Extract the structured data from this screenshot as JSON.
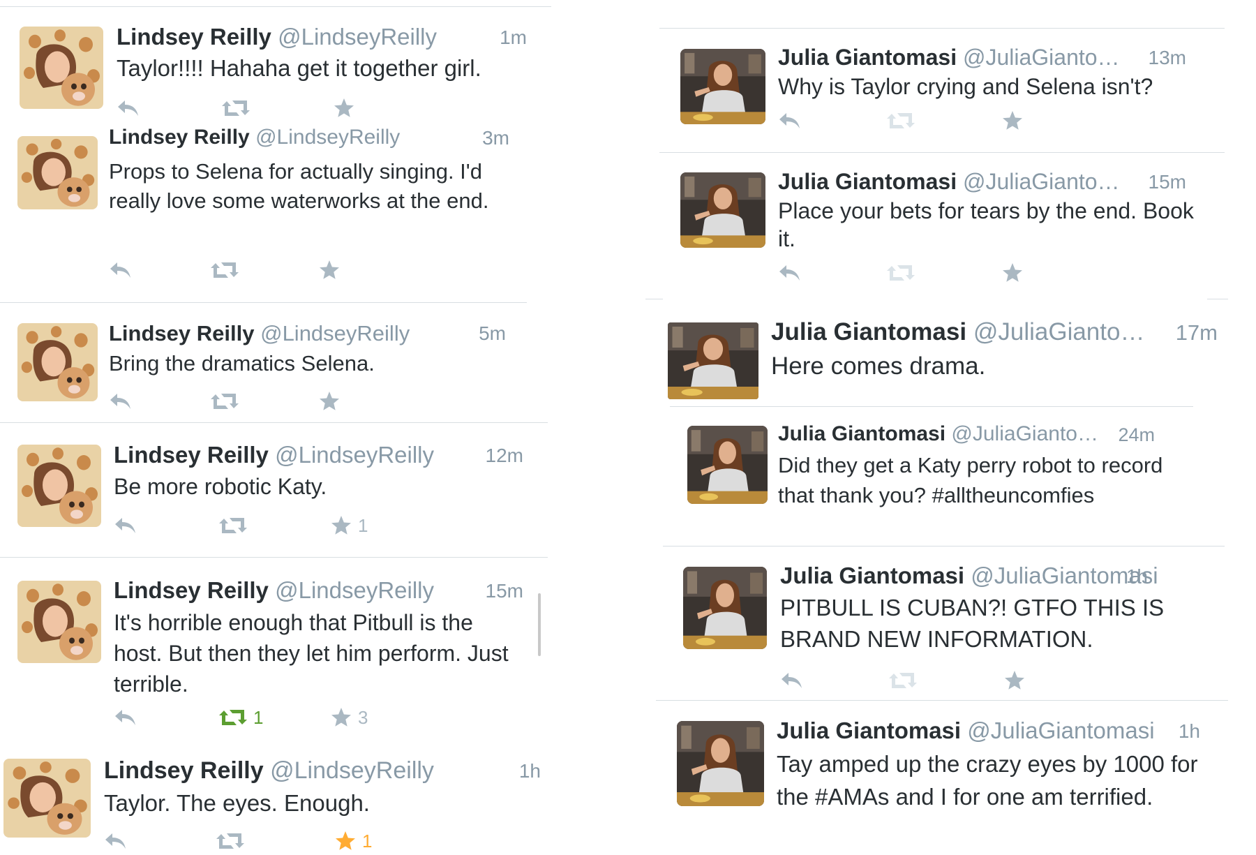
{
  "left_feed": {
    "tweets": [
      {
        "name": "Lindsey Reilly",
        "handle": "@LindseyReilly",
        "time": "1m",
        "text": "Taylor!!!! Hahaha get it together girl.",
        "retweets": "",
        "favorites": ""
      },
      {
        "name": "Lindsey Reilly",
        "handle": "@LindseyReilly",
        "time": "3m",
        "text": "Props to Selena for actually singing. I'd really love some waterworks at the end.",
        "retweets": "",
        "favorites": ""
      },
      {
        "name": "Lindsey Reilly",
        "handle": "@LindseyReilly",
        "time": "5m",
        "text": "Bring the dramatics Selena.",
        "retweets": "",
        "favorites": ""
      },
      {
        "name": "Lindsey Reilly",
        "handle": "@LindseyReilly",
        "time": "12m",
        "text": "Be more robotic Katy.",
        "retweets": "",
        "favorites": "1"
      },
      {
        "name": "Lindsey Reilly",
        "handle": "@LindseyReilly",
        "time": "15m",
        "text": "It's horrible enough that Pitbull is the host. But then they let him perform. Just terrible.",
        "retweets": "1",
        "favorites": "3"
      },
      {
        "name": "Lindsey Reilly",
        "handle": "@LindseyReilly",
        "time": "1h",
        "text": "Taylor. The eyes. Enough.",
        "retweets": "",
        "favorites": "1"
      }
    ]
  },
  "right_feed": {
    "tweets": [
      {
        "name": "Julia Giantomasi",
        "handle": "@JuliaGianto…",
        "time": "13m",
        "text": "Why is Taylor crying and Selena isn't?",
        "retweets": "",
        "favorites": ""
      },
      {
        "name": "Julia Giantomasi",
        "handle": "@JuliaGianto…",
        "time": "15m",
        "text": "Place your bets for tears by the end. Book it.",
        "retweets": "",
        "favorites": ""
      },
      {
        "name": "Julia Giantomasi",
        "handle": "@JuliaGianto…",
        "time": "17m",
        "text": "Here comes drama.",
        "retweets": "",
        "favorites": ""
      },
      {
        "name": "Julia Giantomasi",
        "handle": "@JuliaGianto…",
        "time": "24m",
        "text": "Did they get a Katy perry robot to record that thank you? #alltheuncomfies",
        "retweets": "",
        "favorites": ""
      },
      {
        "name": "Julia Giantomasi",
        "handle": "@JuliaGiantomasi",
        "time": "1h",
        "text": "PITBULL IS CUBAN?! GTFO THIS IS BRAND NEW INFORMATION.",
        "retweets": "",
        "favorites": ""
      },
      {
        "name": "Julia Giantomasi",
        "handle": "@JuliaGiantomasi",
        "time": "1h",
        "text": "Tay amped up the crazy eyes by 1000 for the #AMAs and I for one am terrified.",
        "retweets": "",
        "favorites": ""
      }
    ]
  },
  "icons": {
    "reply": "reply-arrow-icon",
    "retweet": "retweet-icon",
    "favorite": "star-icon",
    "avatar_left": "avatar-giraffe-hood",
    "avatar_right": "avatar-woman-at-table"
  },
  "colors": {
    "name": "#292f33",
    "meta": "#8899a6",
    "action": "#aab8c2",
    "retweeted": "#5c9e31",
    "favorited": "#ffac33",
    "separator": "#d8dee2"
  }
}
